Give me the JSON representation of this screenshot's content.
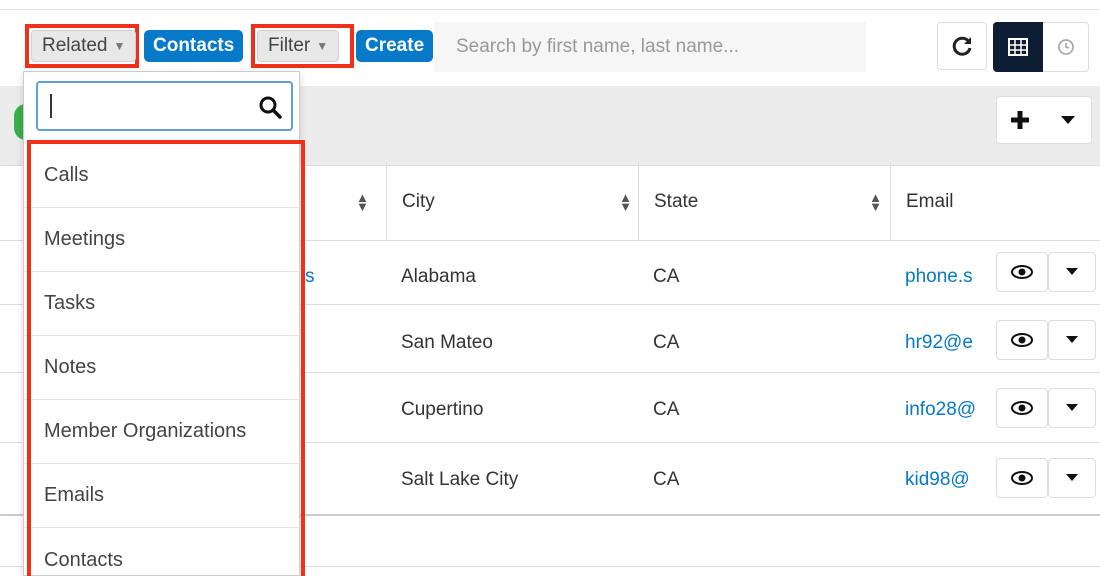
{
  "toolbar": {
    "related_label": "Related",
    "contacts_label": "Contacts",
    "filter_label": "Filter",
    "create_label": "Create",
    "search_placeholder": "Search by first name, last name...",
    "refresh_icon": "refresh-icon",
    "list_view_icon": "grid-icon",
    "activity_view_icon": "clock-icon"
  },
  "related_dropdown": {
    "search_value": "",
    "items": [
      "Calls",
      "Meetings",
      "Tasks",
      "Notes",
      "Member Organizations",
      "Emails",
      "Contacts"
    ]
  },
  "table": {
    "columns": [
      "City",
      "State",
      "Email"
    ],
    "rows": [
      {
        "name_fragment": "s",
        "city": "Alabama",
        "state": "CA",
        "email": "phone.s"
      },
      {
        "name_fragment": "",
        "city": "San Mateo",
        "state": "CA",
        "email": "hr92@e"
      },
      {
        "name_fragment": "",
        "city": "Cupertino",
        "state": "CA",
        "email": "info28@"
      },
      {
        "name_fragment": "",
        "city": "Salt Lake City",
        "state": "CA",
        "email": "kid98@"
      }
    ]
  },
  "colors": {
    "accent": "#0679c8",
    "highlight": "#f0301a",
    "active_view": "#0d1d33",
    "badge": "#3db04b"
  }
}
